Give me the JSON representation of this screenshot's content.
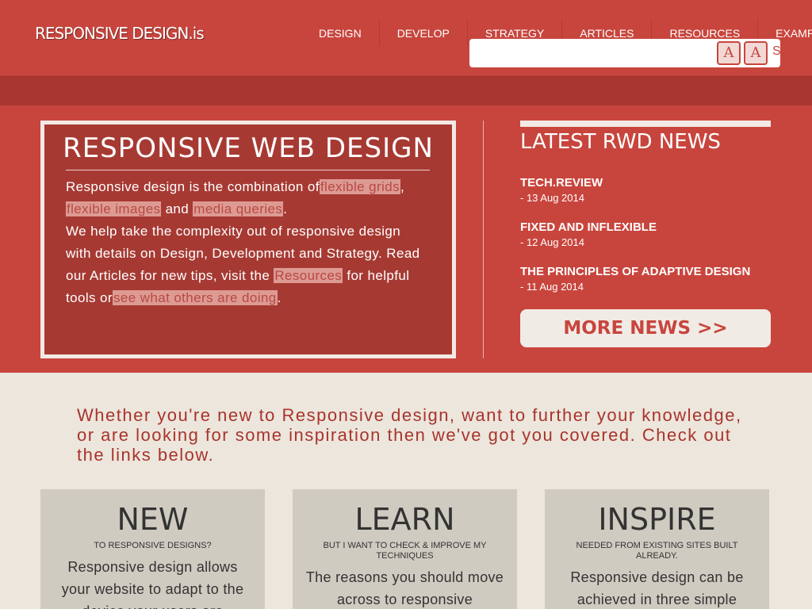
{
  "header": {
    "logo": "RESPONSIVE DESIGN.is",
    "nav": [
      "DESIGN",
      "DEVELOP",
      "STRATEGY",
      "ARTICLES",
      "RESOURCES",
      "EXAMPLES"
    ],
    "search": {
      "value": "",
      "button_a_icon": "font-icon-a",
      "button_b_icon": "font-icon-a-outline",
      "trailing": "S"
    }
  },
  "intro": {
    "title": "RESPONSIVE WEB DESIGN",
    "p1_a": "Responsive design is the combination of",
    "link_grids": "flexible grids",
    "p1_b": ", ",
    "link_images": "flexible images",
    "p1_c": " and ",
    "link_media": "media queries",
    "p1_d": ".",
    "p2_a": "We help take the complexity out of responsive design with details on Design, Development and Strategy. Read our Articles for new tips, visit the ",
    "link_resources": "Resources",
    "p2_b": " for helpful tools or",
    "link_others": "see what others are doing",
    "p2_c": "."
  },
  "news": {
    "title": "LATEST RWD NEWS",
    "items": [
      {
        "title": "TECH.REVIEW",
        "date": "- 13 Aug 2014"
      },
      {
        "title": "FIXED AND INFLEXIBLE",
        "date": "- 12 Aug 2014"
      },
      {
        "title": "THE PRINCIPLES OF ADAPTIVE DESIGN",
        "date": "- 11 Aug 2014"
      }
    ],
    "more": "MORE NEWS >>"
  },
  "tagline": "Whether you're new to Responsive design, want to further your knowledge, or are looking for some inspiration then we've got you covered. Check out the links below.",
  "cards": [
    {
      "title": "NEW",
      "subtitle": "TO RESPONSIVE DESIGNS?",
      "body": "Responsive design allows your website to adapt to the device your users are"
    },
    {
      "title": "LEARN",
      "subtitle": "BUT I WANT TO CHECK & IMPROVE MY TECHNIQUES",
      "body": "The reasons you should move across to responsive"
    },
    {
      "title": "INSPIRE",
      "subtitle": "NEEDED FROM EXISTING SITES BUILT ALREADY.",
      "body": "Responsive design can be achieved in three simple steps. A flexible grid based"
    }
  ],
  "colors": {
    "primary": "#c8453d",
    "dark_band": "#a8372f",
    "panel": "#a63a33",
    "background": "#ece6dc",
    "card": "#cfcbc1",
    "tagline": "#a8342d"
  }
}
